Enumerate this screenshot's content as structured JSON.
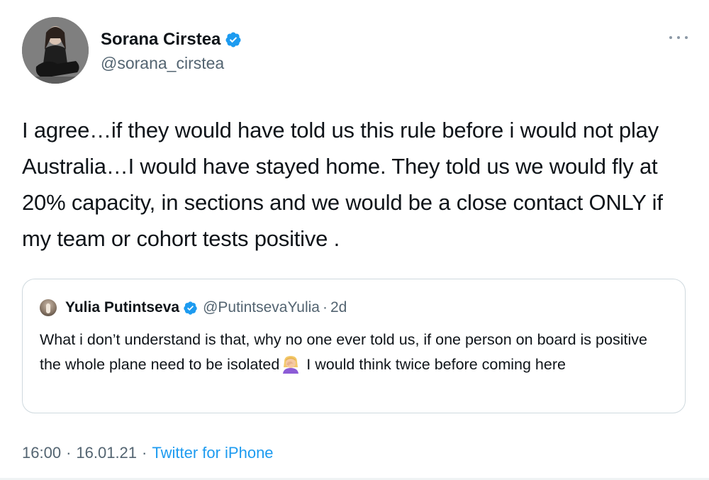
{
  "author": {
    "display_name": "Sorana Cirstea",
    "handle": "@sorana_cirstea",
    "verified": true,
    "avatar_icon": "profile-photo"
  },
  "tweet": {
    "text": "I agree…if they would have told us this rule before i would not play Australia…I would have stayed home. They told us we would fly at 20% capacity, in sections and we would be a close contact ONLY if my team or cohort tests positive ."
  },
  "quoted": {
    "display_name": "Yulia Putintseva",
    "handle": "@PutintsevaYulia",
    "separator": "·",
    "age": "2d",
    "verified": true,
    "text_before_emoji": "What i don’t understand is that, why no one ever told us, if one person on board is positive the whole plane need to be isolated",
    "emoji": "woman-facepalming-emoji",
    "text_after_emoji": " I would think twice before coming here"
  },
  "meta": {
    "time": "16:00",
    "separator": "·",
    "date": "16.01.21",
    "source": "Twitter for iPhone"
  },
  "colors": {
    "text": "#0f1419",
    "secondary": "#536471",
    "accent": "#1d9bf0",
    "border": "#cfd9de"
  },
  "icons": {
    "more": "more-horizontal-icon",
    "verified": "verified-badge-icon"
  }
}
